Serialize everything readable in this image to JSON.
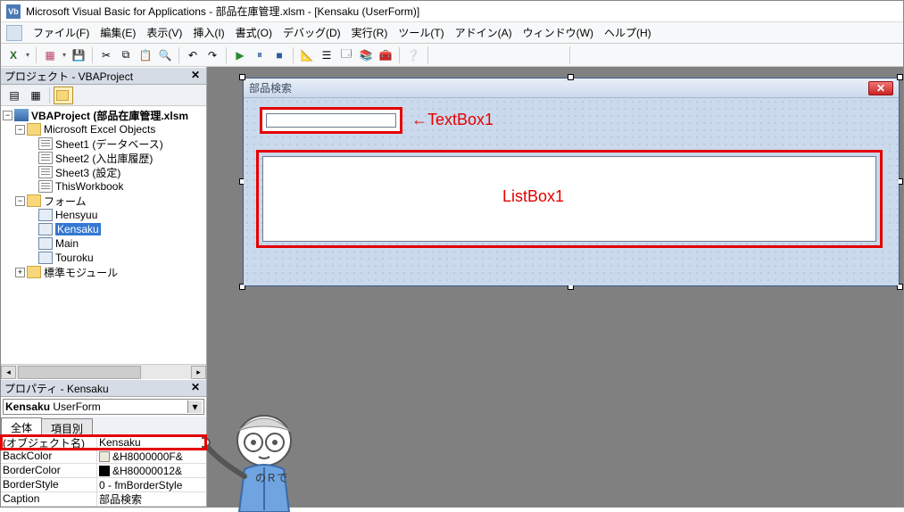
{
  "title": "Microsoft Visual Basic for Applications - 部品在庫管理.xlsm - [Kensaku (UserForm)]",
  "menu": {
    "file": "ファイル(F)",
    "edit": "編集(E)",
    "view": "表示(V)",
    "insert": "挿入(I)",
    "format": "書式(O)",
    "debug": "デバッグ(D)",
    "run": "実行(R)",
    "tools": "ツール(T)",
    "addins": "アドイン(A)",
    "window": "ウィンドウ(W)",
    "help": "ヘルプ(H)"
  },
  "project_panel": {
    "title": "プロジェクト - VBAProject",
    "root": "VBAProject (部品在庫管理.xlsm",
    "excel_objects": "Microsoft Excel Objects",
    "sheets": [
      "Sheet1 (データベース)",
      "Sheet2 (入出庫履歴)",
      "Sheet3 (設定)",
      "ThisWorkbook"
    ],
    "forms_folder": "フォーム",
    "forms": [
      "Hensyuu",
      "Kensaku",
      "Main",
      "Touroku"
    ],
    "modules_folder": "標準モジュール"
  },
  "properties_panel": {
    "title": "プロパティ - Kensaku",
    "combo_name": "Kensaku",
    "combo_type": "UserForm",
    "tab_all": "全体",
    "tab_cat": "項目別",
    "rows": {
      "name_label": "(オブジェクト名)",
      "name_value": "Kensaku",
      "backcolor_label": "BackColor",
      "backcolor_value": "&H8000000F&",
      "bordercolor_label": "BorderColor",
      "bordercolor_value": "&H80000012&",
      "borderstyle_label": "BorderStyle",
      "borderstyle_value": "0 - fmBorderStyle",
      "caption_label": "Caption",
      "caption_value": "部品検索"
    }
  },
  "userform": {
    "caption": "部品検索",
    "textbox_label": "←TextBox1",
    "listbox_label": "ListBox1"
  },
  "icons": {
    "excel": "X",
    "save": "💾",
    "cut": "✂",
    "copy": "⧉",
    "paste": "📋",
    "find": "🔍",
    "undo": "↶",
    "redo": "↷",
    "run": "▶",
    "pause": "⏸",
    "stop": "■",
    "design": "📐",
    "step": "⮓",
    "project": "📁",
    "props": "🗔",
    "objbrowser": "📚",
    "toolbox": "🧰",
    "help": "?"
  }
}
